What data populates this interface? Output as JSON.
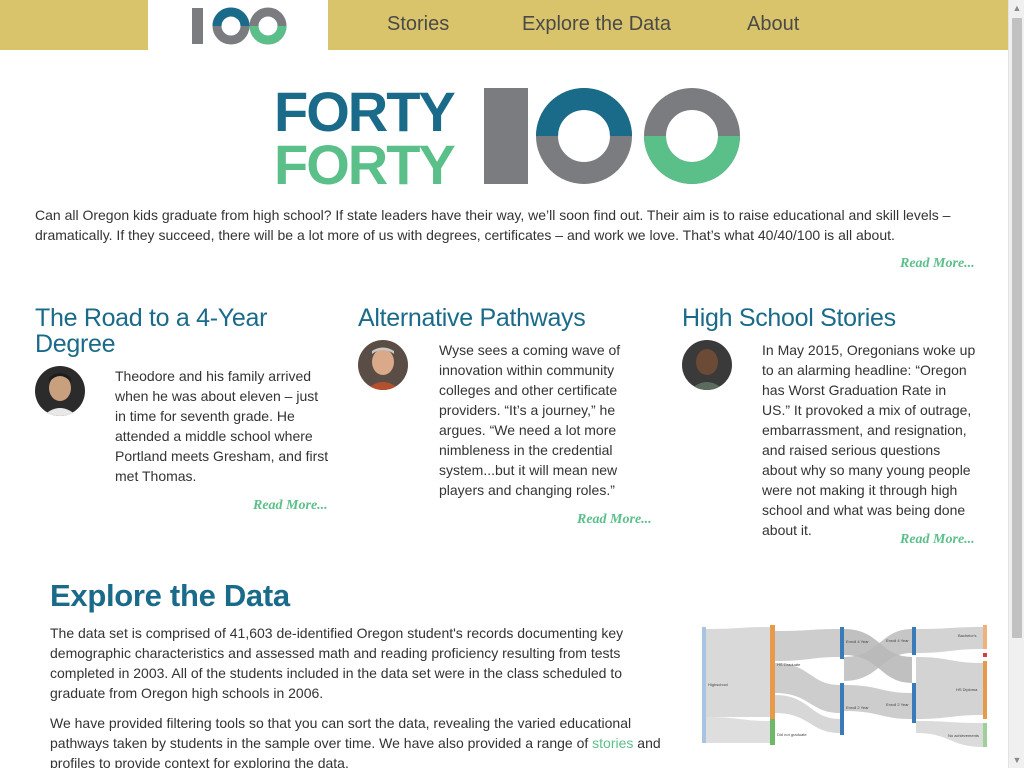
{
  "nav": {
    "logo_text": "100",
    "links": [
      "Stories",
      "Explore the Data",
      "About"
    ]
  },
  "hero": {
    "logo_line1": "FORTY",
    "logo_line2": "FORTY",
    "logo_number": "100"
  },
  "intro": {
    "text": "Can all Oregon kids graduate from high school? If state leaders have their way, we’ll soon find out. Their aim is to raise educational and skill levels – dramatically. If they succeed, there will be a lot more of us with degrees, certificates – and work we love. That’s what 40/40/100 is all about.",
    "read_more": "Read More..."
  },
  "stories": [
    {
      "title": "The Road to a 4-Year Degree",
      "text": "Theodore and his family arrived when he was about eleven – just in time for seventh grade. He attended a middle school where Portland meets Gresham, and first met Thomas.",
      "read_more": "Read More..."
    },
    {
      "title": "Alternative Pathways",
      "text": "Wyse sees a coming wave of innovation within community colleges and other certificate providers. “It’s a journey,” he argues. “We need a lot more nimbleness in the credential system...but it will mean new players and changing roles.”",
      "read_more": "Read More..."
    },
    {
      "title": "High School Stories",
      "text": "In May 2015, Oregonians woke up to an alarming headline: “Oregon has Worst Graduation Rate in US.” It provoked a mix of outrage, embarrassment, and resignation, and raised serious questions about why so many young people were not making it through high school and what was being done about it.",
      "read_more": "Read More..."
    }
  ],
  "explore": {
    "title": "Explore the Data",
    "para1": "The data set is comprised of 41,603 de-identified Oregon student's records documenting key demographic characteristics and assessed math and reading proficiency resulting from tests completed in 2003. All of the students included in the data set were in the class scheduled to graduate from Oregon high schools in 2006.",
    "para2_before": "We have provided filtering tools so that you can sort the data, revealing the varied educational pathways taken by students in the sample over time. We have also provided a range of ",
    "para2_link": "stories",
    "para2_after": " and profiles to provide context for exploring the data."
  },
  "sankey_labels": {
    "source": "Highschool",
    "grad": "HS Graduate",
    "nongrad": "Did not graduate",
    "enroll4_a": "Enroll 4 Year",
    "enroll2_a": "Enroll 2 Year",
    "enroll4_b": "Enroll 4 Year",
    "enroll2_b": "Enroll 2 Year",
    "bachelors": "Bachelor's",
    "hs_diploma": "HS Diploma",
    "no_achievements": "No achievements"
  },
  "colors": {
    "nav_bg": "#d9c46b",
    "teal": "#1a6a8a",
    "green": "#5bbf8a",
    "gray": "#7a7c80"
  }
}
